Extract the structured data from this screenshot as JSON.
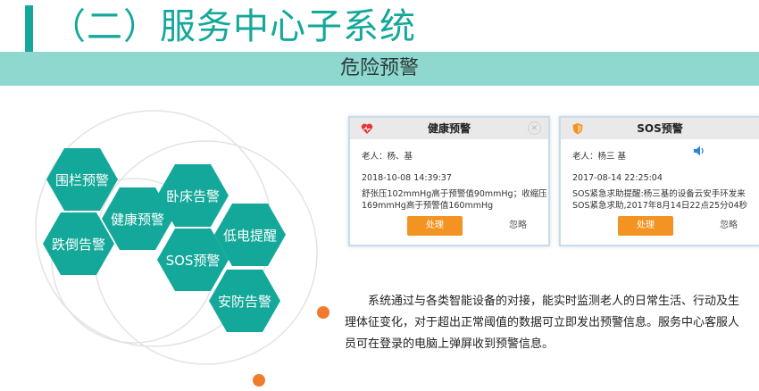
{
  "header": {
    "title": "（二）服务中心子系统",
    "subtitle": "危险预警"
  },
  "hexagons": [
    {
      "id": "fence",
      "label": "围栏预警"
    },
    {
      "id": "health",
      "label": "健康预警"
    },
    {
      "id": "bed",
      "label": "卧床告警"
    },
    {
      "id": "fall",
      "label": "跌倒告警"
    },
    {
      "id": "power",
      "label": "低电提醒"
    },
    {
      "id": "sos",
      "label": "SOS预警"
    },
    {
      "id": "security",
      "label": "安防告警"
    }
  ],
  "health_card": {
    "icon": "heart-alert-icon",
    "title": "健康预警",
    "close": "×",
    "elder": "老人：杨、基",
    "time": "2018-10-08 14:39:37",
    "message_line1": "舒张压102mmHg高于预警值90mmHg；收缩压",
    "message_line2": "169mmHg高于预警值160mmHg",
    "handle_label": "处理",
    "ignore_label": "忽略"
  },
  "sos_card": {
    "icon": "shield-alert-icon",
    "title": "SOS预警",
    "elder": "老人：杨三 基",
    "time": "2017-08-14 22:25:04",
    "message_line1": "SOS紧急求助提醒:杨三基的设备云安手环发来",
    "message_line2": "SOS紧急求助,2017年8月14日22点25分04秒",
    "handle_label": "处理",
    "ignore_label": "忽略",
    "speaker_icon": "speaker-icon"
  },
  "description": "系统通过与各类智能设备的对接，能实时监测老人的日常生活、行动及生理体征变化，对于超出正常阈值的数据可立即发出预警信息。服务中心客服人员可在登录的电脑上弹屏收到预警信息。",
  "colors": {
    "teal": "#14a89a",
    "band": "#8fd8cf",
    "orange": "#f39322",
    "dot": "#f07b2c"
  }
}
